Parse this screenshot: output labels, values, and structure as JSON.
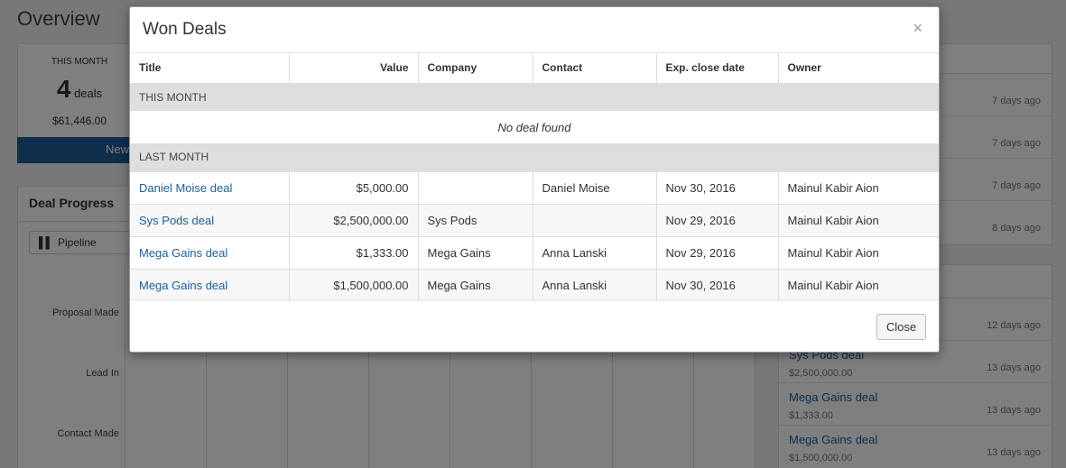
{
  "page": {
    "title": "Overview",
    "stat": {
      "caption": "THIS MONTH",
      "count": "4",
      "unit": "deals",
      "amount": "$61,446.00",
      "bar_label": "New"
    },
    "progress": {
      "title": "Deal Progress",
      "pipeline_label": "Pipeline",
      "stages": [
        "Proposal Made",
        "Lead In",
        "Contact Made"
      ]
    },
    "recent_times": [
      "7 days ago",
      "7 days ago",
      "7 days ago",
      "8 days ago"
    ],
    "won_feed": [
      {
        "title": "",
        "amount": "",
        "time": "12 days ago"
      },
      {
        "title": "Sys Pods deal",
        "amount": "$2,500,000.00",
        "time": "13 days ago"
      },
      {
        "title": "Mega Gains deal",
        "amount": "$1,333.00",
        "time": "13 days ago"
      },
      {
        "title": "Mega Gains deal",
        "amount": "$1,500,000.00",
        "time": "13 days ago"
      }
    ]
  },
  "modal": {
    "title": "Won Deals",
    "close_icon": "×",
    "columns": [
      "Title",
      "Value",
      "Company",
      "Contact",
      "Exp. close date",
      "Owner"
    ],
    "groups": [
      {
        "label": "THIS MONTH",
        "empty_text": "No deal found",
        "rows": []
      },
      {
        "label": "LAST MONTH",
        "rows": [
          {
            "title": "Daniel Moise deal",
            "value": "$5,000.00",
            "company": "",
            "contact": "Daniel Moise",
            "close_date": "Nov 30, 2016",
            "owner": "Mainul Kabir Aion"
          },
          {
            "title": "Sys Pods deal",
            "value": "$2,500,000.00",
            "company": "Sys Pods",
            "contact": "",
            "close_date": "Nov 29, 2016",
            "owner": "Mainul Kabir Aion"
          },
          {
            "title": "Mega Gains deal",
            "value": "$1,333.00",
            "company": "Mega Gains",
            "contact": "Anna Lanski",
            "close_date": "Nov 29, 2016",
            "owner": "Mainul Kabir Aion"
          },
          {
            "title": "Mega Gains deal",
            "value": "$1,500,000.00",
            "company": "Mega Gains",
            "contact": "Anna Lanski",
            "close_date": "Nov 30, 2016",
            "owner": "Mainul Kabir Aion"
          }
        ]
      }
    ],
    "close_button": "Close"
  },
  "colors": {
    "accent": "#1c5d99",
    "link": "#1a5f9c",
    "group_bg": "#dedede"
  }
}
